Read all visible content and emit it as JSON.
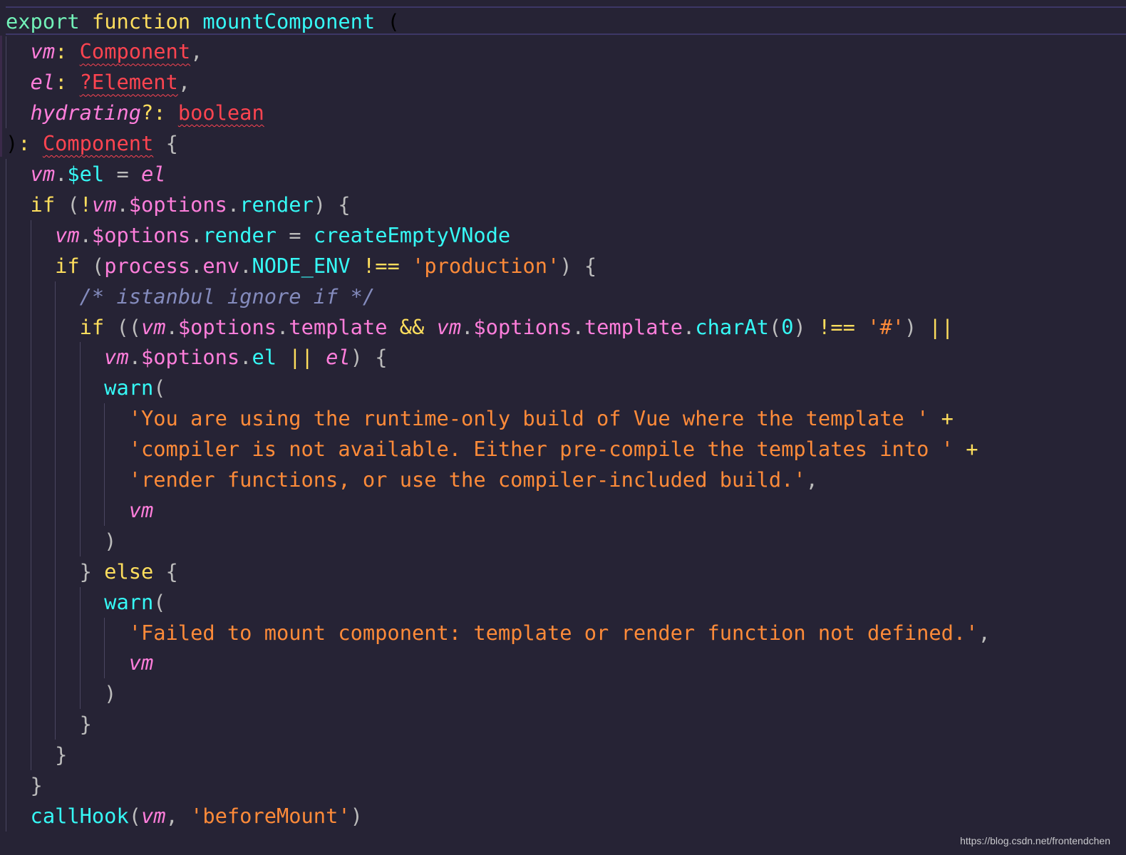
{
  "editor": {
    "theme_colors": {
      "background": "#262335",
      "keyword": "#fede5d",
      "function": "#36f9f6",
      "parameter": "#ff7edb",
      "type": "#fe4450",
      "string": "#ff8b39",
      "comment": "#848bbd"
    },
    "lines": [
      [
        [
          "ex",
          "export"
        ],
        [
          "p",
          " "
        ],
        [
          "kw",
          "function"
        ],
        [
          "p",
          " "
        ],
        [
          "fn",
          "mountComponent"
        ],
        [
          "p",
          " "
        ],
        [
          "br",
          "("
        ]
      ],
      [
        [
          "p",
          "  "
        ],
        [
          "param",
          "vm"
        ],
        [
          "op",
          ":"
        ],
        [
          "p",
          " "
        ],
        [
          "type",
          "Component"
        ],
        [
          "p",
          ","
        ]
      ],
      [
        [
          "p",
          "  "
        ],
        [
          "param",
          "el"
        ],
        [
          "op",
          ":"
        ],
        [
          "p",
          " "
        ],
        [
          "type",
          "?Element"
        ],
        [
          "p",
          ","
        ]
      ],
      [
        [
          "p",
          "  "
        ],
        [
          "param",
          "hydrating"
        ],
        [
          "op",
          "?:"
        ],
        [
          "p",
          " "
        ],
        [
          "type",
          "boolean"
        ]
      ],
      [
        [
          "br",
          ")"
        ],
        [
          "op",
          ":"
        ],
        [
          "p",
          " "
        ],
        [
          "type",
          "Component"
        ],
        [
          "p",
          " {"
        ]
      ],
      [
        [
          "p",
          "  "
        ],
        [
          "param",
          "vm"
        ],
        [
          "p",
          "."
        ],
        [
          "fn",
          "$el"
        ],
        [
          "p",
          " = "
        ],
        [
          "param",
          "el"
        ]
      ],
      [
        [
          "p",
          "  "
        ],
        [
          "kw",
          "if"
        ],
        [
          "p",
          " ("
        ],
        [
          "op",
          "!"
        ],
        [
          "param",
          "vm"
        ],
        [
          "p",
          "."
        ],
        [
          "prop",
          "$options"
        ],
        [
          "p",
          "."
        ],
        [
          "fn",
          "render"
        ],
        [
          "p",
          ") {"
        ]
      ],
      [
        [
          "p",
          "    "
        ],
        [
          "param",
          "vm"
        ],
        [
          "p",
          "."
        ],
        [
          "prop",
          "$options"
        ],
        [
          "p",
          "."
        ],
        [
          "fn",
          "render"
        ],
        [
          "p",
          " = "
        ],
        [
          "fn",
          "createEmptyVNode"
        ]
      ],
      [
        [
          "p",
          "    "
        ],
        [
          "kw",
          "if"
        ],
        [
          "p",
          " ("
        ],
        [
          "prop",
          "process"
        ],
        [
          "p",
          "."
        ],
        [
          "prop",
          "env"
        ],
        [
          "p",
          "."
        ],
        [
          "fn",
          "NODE_ENV"
        ],
        [
          "p",
          " "
        ],
        [
          "op",
          "!=="
        ],
        [
          "p",
          " "
        ],
        [
          "str",
          "'production'"
        ],
        [
          "p",
          ") {"
        ]
      ],
      [
        [
          "p",
          "      "
        ],
        [
          "cm",
          "/* istanbul ignore if */"
        ]
      ],
      [
        [
          "p",
          "      "
        ],
        [
          "kw",
          "if"
        ],
        [
          "p",
          " (("
        ],
        [
          "param",
          "vm"
        ],
        [
          "p",
          "."
        ],
        [
          "prop",
          "$options"
        ],
        [
          "p",
          "."
        ],
        [
          "prop",
          "template"
        ],
        [
          "p",
          " "
        ],
        [
          "op",
          "&&"
        ],
        [
          "p",
          " "
        ],
        [
          "param",
          "vm"
        ],
        [
          "p",
          "."
        ],
        [
          "prop",
          "$options"
        ],
        [
          "p",
          "."
        ],
        [
          "prop",
          "template"
        ],
        [
          "p",
          "."
        ],
        [
          "fn",
          "charAt"
        ],
        [
          "p",
          "("
        ],
        [
          "num",
          "0"
        ],
        [
          "p",
          ") "
        ],
        [
          "op",
          "!=="
        ],
        [
          "p",
          " "
        ],
        [
          "str",
          "'#'"
        ],
        [
          "p",
          ") "
        ],
        [
          "op",
          "||"
        ]
      ],
      [
        [
          "p",
          "        "
        ],
        [
          "param",
          "vm"
        ],
        [
          "p",
          "."
        ],
        [
          "prop",
          "$options"
        ],
        [
          "p",
          "."
        ],
        [
          "fn",
          "el"
        ],
        [
          "p",
          " "
        ],
        [
          "op",
          "||"
        ],
        [
          "p",
          " "
        ],
        [
          "param",
          "el"
        ],
        [
          "p",
          ") {"
        ]
      ],
      [
        [
          "p",
          "        "
        ],
        [
          "fn",
          "warn"
        ],
        [
          "p",
          "("
        ]
      ],
      [
        [
          "p",
          "          "
        ],
        [
          "str",
          "'You are using the runtime-only build of Vue where the template '"
        ],
        [
          "p",
          " "
        ],
        [
          "op",
          "+"
        ]
      ],
      [
        [
          "p",
          "          "
        ],
        [
          "str",
          "'compiler is not available. Either pre-compile the templates into '"
        ],
        [
          "p",
          " "
        ],
        [
          "op",
          "+"
        ]
      ],
      [
        [
          "p",
          "          "
        ],
        [
          "str",
          "'render functions, or use the compiler-included build.'"
        ],
        [
          "p",
          ","
        ]
      ],
      [
        [
          "p",
          "          "
        ],
        [
          "param",
          "vm"
        ]
      ],
      [
        [
          "p",
          "        )"
        ]
      ],
      [
        [
          "p",
          "      } "
        ],
        [
          "kw",
          "else"
        ],
        [
          "p",
          " {"
        ]
      ],
      [
        [
          "p",
          "        "
        ],
        [
          "fn",
          "warn"
        ],
        [
          "p",
          "("
        ]
      ],
      [
        [
          "p",
          "          "
        ],
        [
          "str",
          "'Failed to mount component: template or render function not defined.'"
        ],
        [
          "p",
          ","
        ]
      ],
      [
        [
          "p",
          "          "
        ],
        [
          "param",
          "vm"
        ]
      ],
      [
        [
          "p",
          "        )"
        ]
      ],
      [
        [
          "p",
          "      }"
        ]
      ],
      [
        [
          "p",
          "    }"
        ]
      ],
      [
        [
          "p",
          "  }"
        ]
      ],
      [
        [
          "p",
          "  "
        ],
        [
          "fn",
          "callHook"
        ],
        [
          "p",
          "("
        ],
        [
          "param",
          "vm"
        ],
        [
          "p",
          ", "
        ],
        [
          "str",
          "'beforeMount'"
        ],
        [
          "p",
          ")"
        ]
      ]
    ]
  },
  "watermark": "https://blog.csdn.net/frontendchen"
}
